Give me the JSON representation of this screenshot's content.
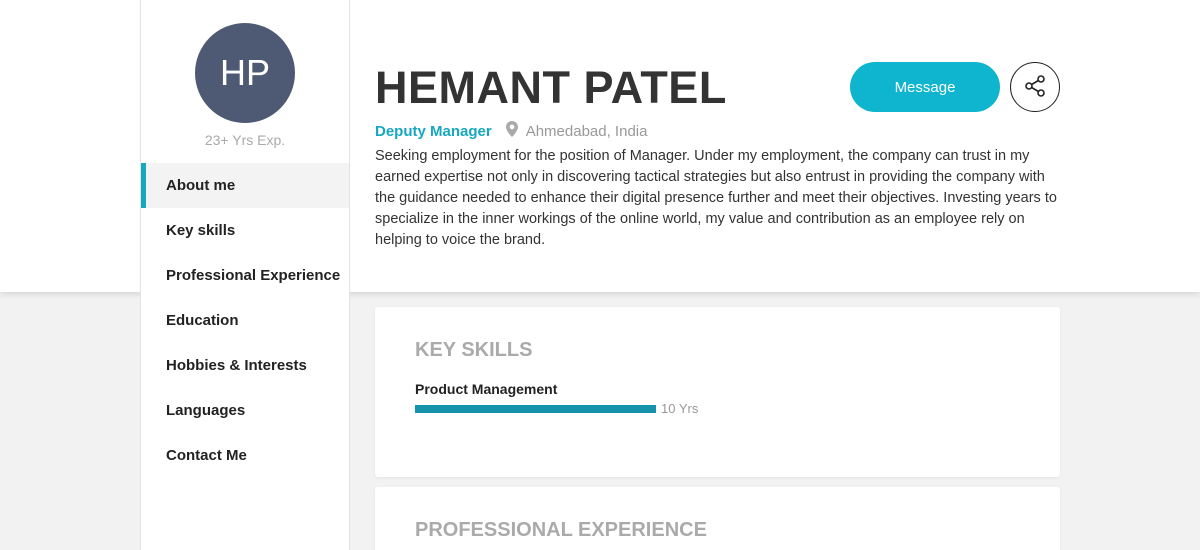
{
  "profile": {
    "initials": "HP",
    "experience": "23+ Yrs Exp.",
    "name": "HEMANT PATEL",
    "role": "Deputy Manager",
    "location": "Ahmedabad, India",
    "about": "Seeking employment for the position of Manager. Under my employment, the company can trust in my earned expertise not only in discovering tactical strategies but also entrust in providing the company with the guidance needed to enhance their digital presence further and meet their objectives. Investing years to specialize in the inner workings of the online world, my value and contribution as an employee rely on helping to voice the brand."
  },
  "actions": {
    "message_label": "Message",
    "share_icon": "share-icon"
  },
  "sidebar": {
    "items": [
      {
        "label": "About me",
        "active": true
      },
      {
        "label": "Key skills"
      },
      {
        "label": "Professional Experience"
      },
      {
        "label": "Education"
      },
      {
        "label": "Hobbies & Interests"
      },
      {
        "label": "Languages"
      },
      {
        "label": "Contact Me"
      }
    ]
  },
  "key_skills": {
    "title": "KEY SKILLS",
    "items": [
      {
        "name": "Product Management",
        "years": "10 Yrs"
      }
    ]
  },
  "professional_experience": {
    "title": "PROFESSIONAL EXPERIENCE"
  },
  "colors": {
    "accent": "#0fb5cf",
    "avatar_bg": "#4e5a73",
    "skill_bar": "#1493ab"
  }
}
